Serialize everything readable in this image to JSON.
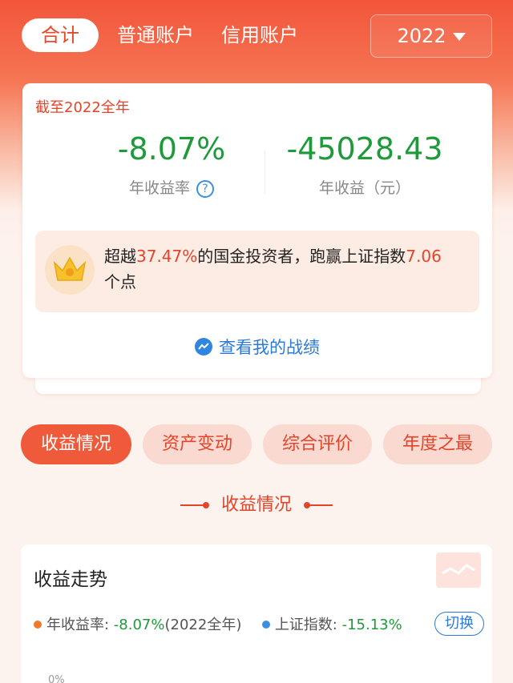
{
  "header": {
    "tabs": [
      {
        "label": "合计",
        "active": true
      },
      {
        "label": "普通账户",
        "active": false
      },
      {
        "label": "信用账户",
        "active": false
      }
    ],
    "year": "2022"
  },
  "summary": {
    "heading": "截至2022全年",
    "annual_return_rate": "-8.07%",
    "annual_return_rate_label": "年收益率",
    "annual_profit": "-45028.43",
    "annual_profit_label": "年收益（元）",
    "beat": {
      "prefix": "超越",
      "percent": "37.47%",
      "middle": "的国金投资者，跑赢上证指数",
      "points": "7.06",
      "suffix": "个点"
    },
    "link_label": "查看我的战绩"
  },
  "segments": [
    "收益情况",
    "资产变动",
    "综合评价",
    "年度之最"
  ],
  "section_title": "收益情况",
  "trend": {
    "title": "收益走势",
    "legend": {
      "own_label": "年收益率: ",
      "own_value": "-8.07%",
      "own_period": "(2022全年)",
      "index_label": "上证指数: ",
      "index_value": "-15.13%"
    },
    "switch_label": "切换",
    "axis_zero": "0%"
  },
  "colors": {
    "accent": "#e3442a",
    "positive_green": "#1e9a3a",
    "link_blue": "#2b7ad6",
    "legend_orange": "#f07a2a",
    "legend_blue": "#3d8fe0"
  },
  "icons": [
    "caret-down-icon",
    "help-icon",
    "crown-icon",
    "chart-link-icon"
  ]
}
